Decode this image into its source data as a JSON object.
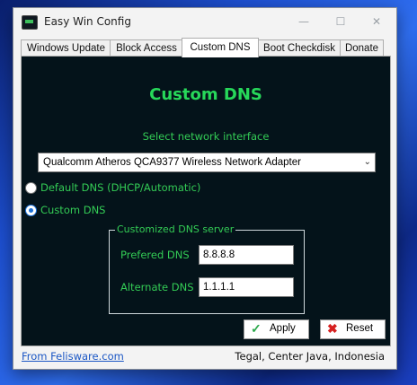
{
  "window": {
    "title": "Easy Win Config",
    "minimize": "—",
    "maximize": "☐",
    "close": "✕"
  },
  "tabs": [
    {
      "label": "Windows Update"
    },
    {
      "label": "Block Access"
    },
    {
      "label": "Custom DNS"
    },
    {
      "label": "Boot Checkdisk"
    },
    {
      "label": "Donate"
    }
  ],
  "active_tab": "Custom DNS",
  "panel": {
    "heading": "Custom DNS",
    "interface_label": "Select network interface",
    "interface_value": "Qualcomm Atheros QCA9377 Wireless Network Adapter",
    "radio_default": "Default DNS (DHCP/Automatic)",
    "radio_custom": "Custom DNS",
    "selected_radio": "Custom DNS",
    "group_title": "Customized DNS server",
    "preferred_label": "Prefered DNS",
    "preferred_value": "8.8.8.8",
    "alternate_label": "Alternate DNS",
    "alternate_value": "1.1.1.1",
    "apply_label": "Apply",
    "reset_label": "Reset"
  },
  "footer": {
    "link": "From Felisware.com",
    "location": "Tegal, Center Java, Indonesia"
  },
  "colors": {
    "accent_green": "#27d85a",
    "panel_bg": "#04131a",
    "apply_icon": "#2aa84a",
    "reset_icon": "#d62020"
  }
}
